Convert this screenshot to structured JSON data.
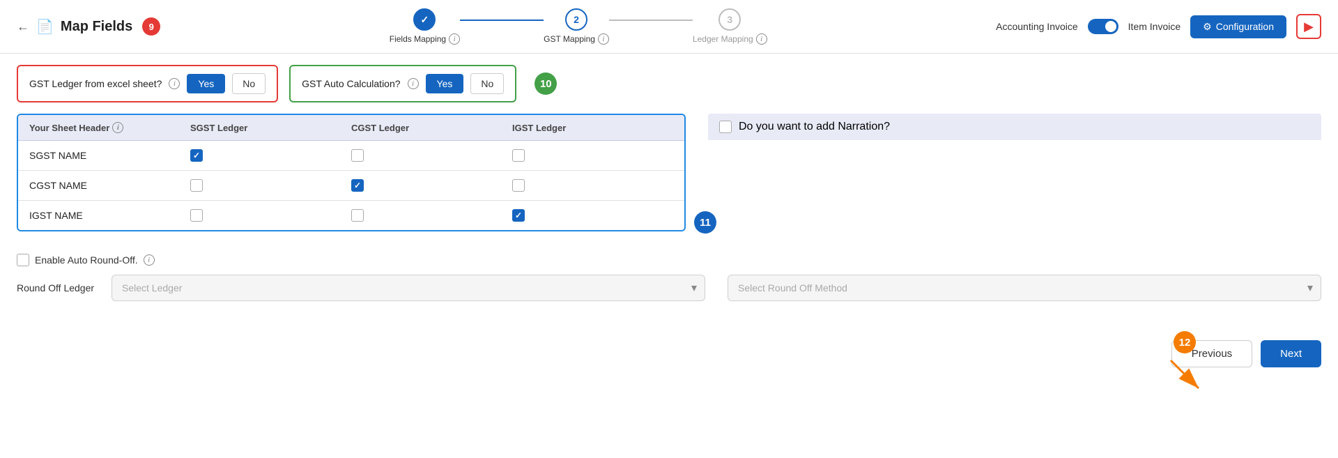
{
  "header": {
    "back_label": "←",
    "doc_icon": "📄",
    "title": "Map Fields",
    "badge_9": "9",
    "accounting_invoice_label": "Accounting Invoice",
    "item_invoice_label": "Item Invoice",
    "config_label": "Configuration",
    "config_icon": "⚙",
    "youtube_icon": "▶"
  },
  "stepper": {
    "step1": {
      "label": "Fields Mapping",
      "number": "✓",
      "completed": true
    },
    "step2": {
      "label": "GST Mapping",
      "number": "2",
      "completed": false
    },
    "step3": {
      "label": "Ledger Mapping",
      "number": "3",
      "completed": false
    }
  },
  "questions": {
    "gst_ledger": {
      "text": "GST Ledger from excel sheet?",
      "yes_label": "Yes",
      "no_label": "No"
    },
    "gst_auto": {
      "text": "GST Auto Calculation?",
      "yes_label": "Yes",
      "no_label": "No",
      "badge": "10"
    }
  },
  "table": {
    "headers": [
      "Your Sheet Header",
      "SGST Ledger",
      "CGST Ledger",
      "IGST Ledger"
    ],
    "rows": [
      {
        "name": "SGST NAME",
        "sgst": true,
        "cgst": false,
        "igst": false
      },
      {
        "name": "CGST NAME",
        "sgst": false,
        "cgst": true,
        "igst": false
      },
      {
        "name": "IGST NAME",
        "sgst": false,
        "cgst": false,
        "igst": true
      }
    ],
    "badge_11": "11"
  },
  "narration": {
    "text": "Do you want to add Narration?"
  },
  "roundoff": {
    "label": "Enable Auto Round-Off.",
    "field_label": "Round Off Ledger",
    "select_ledger_placeholder": "Select Ledger",
    "select_method_placeholder": "Select Round Off Method"
  },
  "footer": {
    "prev_label": "Previous",
    "next_label": "Next",
    "badge_12": "12"
  }
}
